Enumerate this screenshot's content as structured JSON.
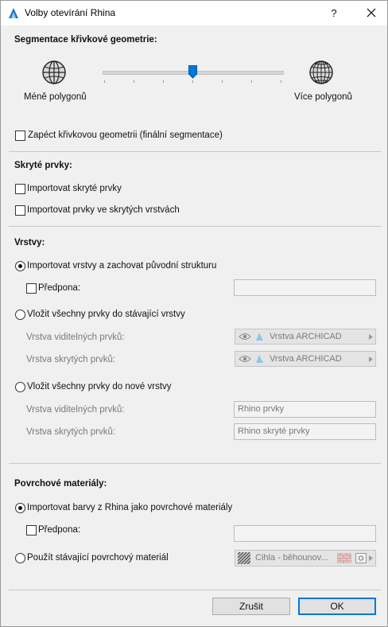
{
  "window": {
    "title": "Volby otevírání Rhina",
    "help": "?"
  },
  "segmentation": {
    "heading": "Segmentace křivkové geometrie:",
    "fewer_label": "Méně polygonů",
    "more_label": "Více polygonů",
    "slider_level": 0.5,
    "bake_checkbox": "Zapéct křivkovou geometrii (finální segmentace)",
    "bake_checked": false
  },
  "hidden": {
    "heading": "Skryté prvky:",
    "import_hidden": "Importovat skryté prvky",
    "import_hidden_checked": false,
    "import_hidden_layers": "Importovat prvky ve skrytých vrstvách",
    "import_hidden_layers_checked": false
  },
  "layers": {
    "heading": "Vrstvy:",
    "option1": "Importovat vrstvy a zachovat původní strukturu",
    "prefix_label": "Předpona:",
    "prefix_value": "",
    "option2": "Vložit všechny prvky do stávající vrstvy",
    "visible_label": "Vrstva viditelných prvků:",
    "visible_value": "Vrstva ARCHICAD",
    "hidden_label": "Vrstva skrytých prvků:",
    "hidden_value": "Vrstva ARCHICAD",
    "option3": "Vložit všechny prvky do nové vrstvy",
    "new_visible_label": "Vrstva viditelných prvků:",
    "new_visible_value": "Rhino prvky",
    "new_hidden_label": "Vrstva skrytých prvků:",
    "new_hidden_value": "Rhino skryté prvky",
    "selected_option": 1
  },
  "materials": {
    "heading": "Povrchové materiály:",
    "option1": "Importovat barvy z Rhina jako povrchové materiály",
    "prefix_label": "Předpona:",
    "prefix_value": "",
    "option2": "Použít stávající povrchový materiál",
    "material_value": "Cihla - běhounov...",
    "selected_option": 1
  },
  "buttons": {
    "cancel": "Zrušit",
    "ok": "OK"
  },
  "colors": {
    "accent": "#0078d7",
    "layer_icon": "#5aa9d8"
  },
  "icons": [
    "app-icon",
    "close-icon",
    "globe-icon",
    "eye-icon",
    "layer-icon",
    "material-swatch-icon",
    "arrow-right-icon"
  ]
}
